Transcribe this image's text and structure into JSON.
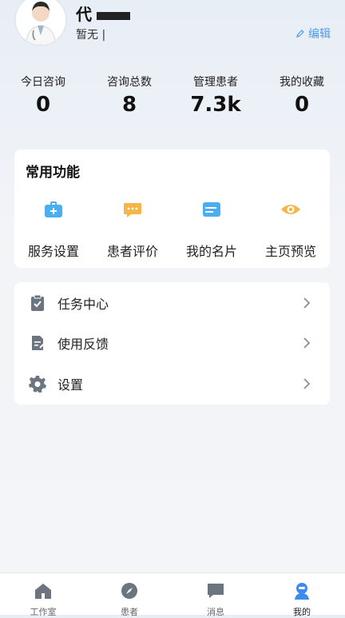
{
  "profile": {
    "name": "代",
    "subtitle": "暂无 |",
    "edit_label": "编辑"
  },
  "stats": [
    {
      "label": "今日咨询",
      "value": "0"
    },
    {
      "label": "咨询总数",
      "value": "8"
    },
    {
      "label": "管理患者",
      "value": "7.3k"
    },
    {
      "label": "我的收藏",
      "value": "0"
    }
  ],
  "functions": {
    "title": "常用功能",
    "items": [
      {
        "label": "服务设置",
        "icon": "medical-kit-icon",
        "color": "#4aaef0"
      },
      {
        "label": "患者评价",
        "icon": "chat-bubble-icon",
        "color": "#f5b547"
      },
      {
        "label": "我的名片",
        "icon": "id-card-icon",
        "color": "#4aaef0"
      },
      {
        "label": "主页预览",
        "icon": "eye-icon",
        "color": "#f5b547"
      }
    ]
  },
  "menu": [
    {
      "label": "任务中心",
      "icon": "clipboard-check-icon"
    },
    {
      "label": "使用反馈",
      "icon": "feedback-doc-icon"
    },
    {
      "label": "设置",
      "icon": "gear-icon"
    }
  ],
  "tabs": [
    {
      "label": "工作室",
      "icon": "home-icon"
    },
    {
      "label": "患者",
      "icon": "compass-icon"
    },
    {
      "label": "消息",
      "icon": "message-icon"
    },
    {
      "label": "我的",
      "icon": "user-icon",
      "active": true
    }
  ],
  "colors": {
    "accent": "#4d9bea",
    "active_tab": "#3e8bf0",
    "icon_gray": "#6b7580"
  }
}
